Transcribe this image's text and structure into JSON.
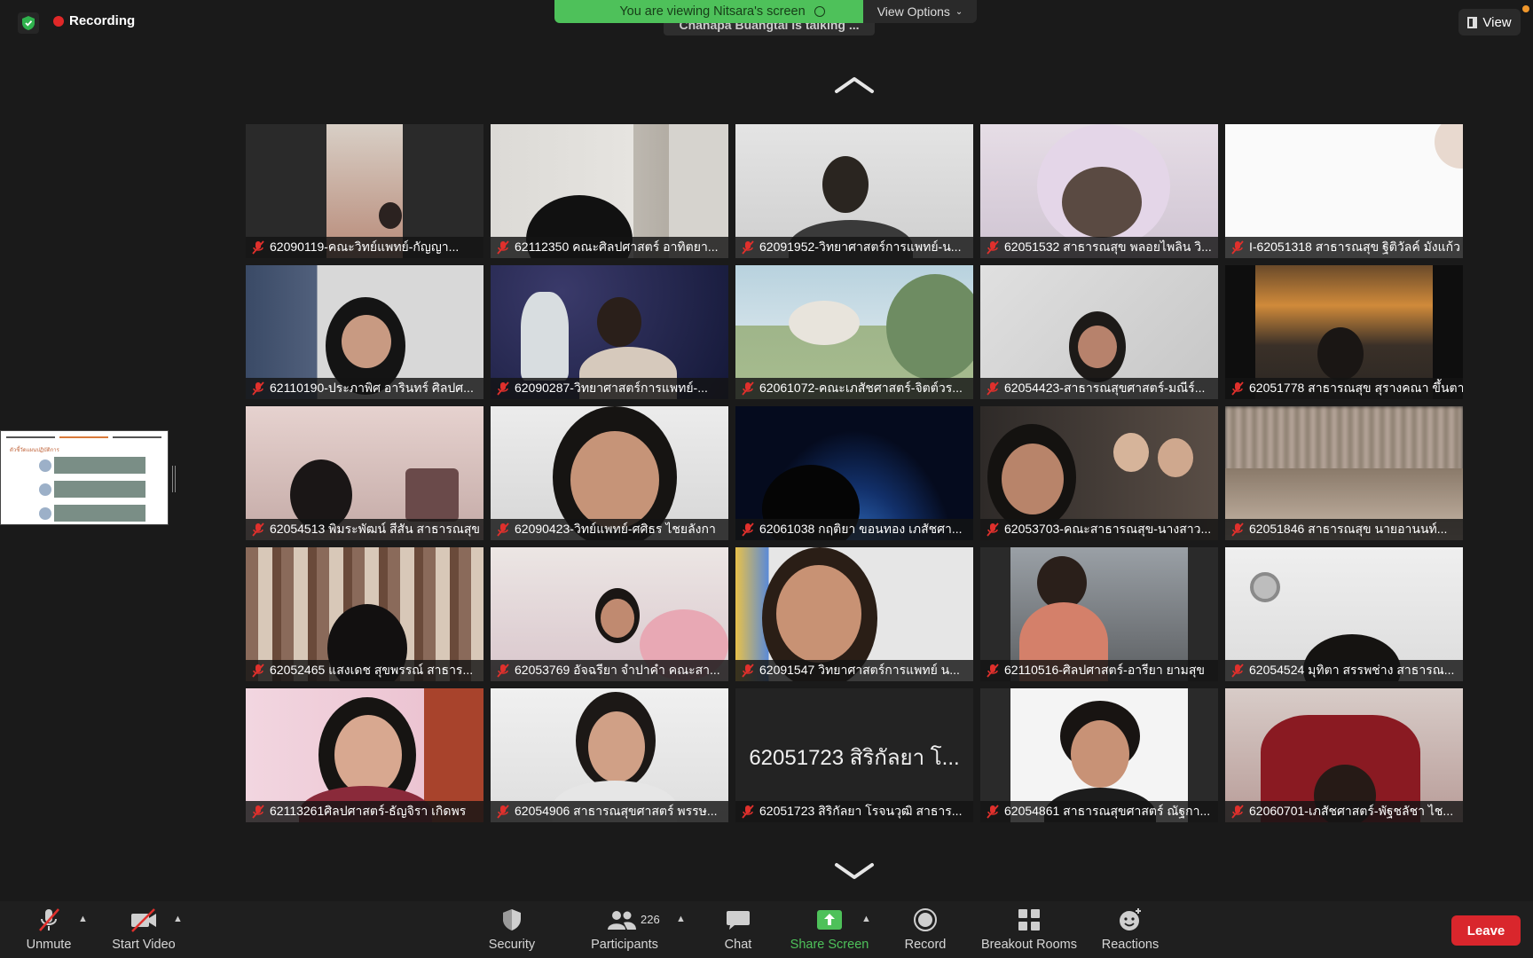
{
  "topbar": {
    "recording_label": "Recording",
    "speaker_text": "Chanapa Buangtai is talking ...",
    "share_banner": "You are viewing Nitsara's screen",
    "view_options": "View Options",
    "view_label": "View"
  },
  "participants": [
    {
      "name": "62090119-คณะวิทย์แพทย์-กัญญา..."
    },
    {
      "name": "62112350 คณะศิลปศาสตร์ อาทิตยา..."
    },
    {
      "name": "62091952-วิทยาศาสตร์การแพทย์-น..."
    },
    {
      "name": "62051532 สาธารณสุข พลอยไพลิน วิ..."
    },
    {
      "name": "I-62051318 สาธารณสุข ฐิติวัลค์ มังแก้ว"
    },
    {
      "name": "62110190-ประภาพิศ อารินทร์ ศิลปศ..."
    },
    {
      "name": "62090287-วิทยาศาสตร์การแพทย์-..."
    },
    {
      "name": "62061072-คณะเภสัชศาสตร์-จิตต์วร..."
    },
    {
      "name": "62054423-สาธารณสุขศาสตร์-มณีร์..."
    },
    {
      "name": "62051778 สาธารณสุข สุรางคณา ขึ้นตา"
    },
    {
      "name": "62054513 พิมระพัฒน์ สีสัน สาธารณสุข"
    },
    {
      "name": "62090423-วิทย์แพทย์-ศศิธร ไชยลังกา"
    },
    {
      "name": "62061038 กฤติยา ขอนทอง เภสัชศา..."
    },
    {
      "name": "62053703-คณะสาธารณสุข-นางสาว..."
    },
    {
      "name": "62051846 สาธารณสุข นายอานนท์..."
    },
    {
      "name": "62052465 แสงเดช สุขพรรณ์ สาธาร..."
    },
    {
      "name": "62053769 อัจฉรียา จำปาคำ คณะสา..."
    },
    {
      "name": "62091547 วิทยาศาสตร์การแพทย์ น..."
    },
    {
      "name": "62110516-ศิลปศาสตร์-อารียา ยามสุข"
    },
    {
      "name": "62054524 มุทิตา สรรพช่าง สาธารณ..."
    },
    {
      "name": "62113261ศิลปศาสตร์-ธัญจิรา เกิดพร"
    },
    {
      "name": "62054906 สาธารณสุขศาสตร์ พรรษ..."
    },
    {
      "name": "62051723 สิริกัลยา โรจนวุฒิ สาธาร...",
      "big_name": "62051723 สิริกัลยา โ..."
    },
    {
      "name": "62054861 สาธารณสุขศาสตร์ ณัฐกา..."
    },
    {
      "name": "62060701-เภสัชศาสตร์-พัฐชลัชา ไช..."
    }
  ],
  "shared_thumb": {
    "title": "ตัวชี้วัดแผนปฏิบัติการ"
  },
  "toolbar": {
    "unmute": "Unmute",
    "start_video": "Start Video",
    "security": "Security",
    "participants": "Participants",
    "participant_count": "226",
    "chat": "Chat",
    "share_screen": "Share Screen",
    "record": "Record",
    "breakout_rooms": "Breakout Rooms",
    "reactions": "Reactions",
    "leave": "Leave"
  },
  "colors": {
    "share_green": "#4ec15a",
    "leave_red": "#d9262c",
    "recording_red": "#e02828",
    "mute_red": "#e0302c"
  }
}
